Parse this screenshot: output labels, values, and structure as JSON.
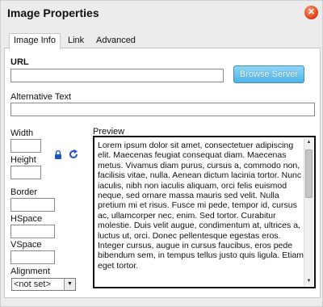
{
  "dialog": {
    "title": "Image Properties",
    "close_symbol": "✕",
    "close_icon": "close-icon"
  },
  "tabs": [
    {
      "label": "Image Info",
      "active": true
    },
    {
      "label": "Link",
      "active": false
    },
    {
      "label": "Advanced",
      "active": false
    }
  ],
  "image_info": {
    "url_label": "URL",
    "url_value": "",
    "browse_button_label": "Browse Server",
    "alt_text_label": "Alternative Text",
    "alt_text_value": "",
    "width_label": "Width",
    "width_value": "",
    "height_label": "Height",
    "height_value": "",
    "lock_ratio_icon": "lock-icon",
    "reset_size_icon": "reset-size-icon",
    "border_label": "Border",
    "border_value": "",
    "hspace_label": "HSpace",
    "hspace_value": "",
    "vspace_label": "VSpace",
    "vspace_value": "",
    "alignment_label": "Alignment",
    "alignment_selected": "<not set>",
    "preview_label": "Preview",
    "preview_text": "Lorem ipsum dolor sit amet, consectetuer adipiscing elit. Maecenas feugiat consequat diam. Maecenas metus. Vivamus diam purus, cursus a, commodo non, facilisis vitae, nulla. Aenean dictum lacinia tortor. Nunc iaculis, nibh non iaculis aliquam, orci felis euismod neque, sed ornare massa mauris sed velit. Nulla pretium mi et risus. Fusce mi pede, tempor id, cursus ac, ullamcorper nec, enim. Sed tortor. Curabitur molestie. Duis velit augue, condimentum at, ultrices a, luctus ut, orci. Donec pellentesque egestas eros. Integer cursus, augue in cursus faucibus, eros pede bibendum sem, in tempus tellus justo quis ligula. Etiam eget tortor."
  },
  "colors": {
    "browse_button": "#4db4e6",
    "close_button": "#e0401a",
    "icon_blue": "#1a56c9"
  }
}
